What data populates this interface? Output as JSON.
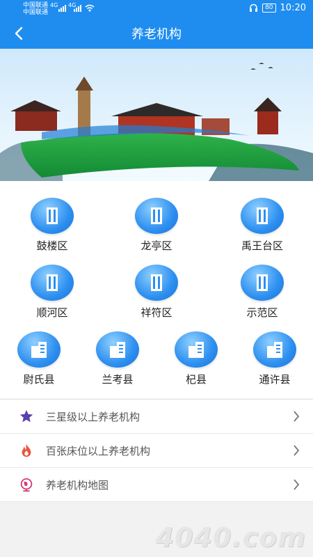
{
  "status": {
    "carrier1": "中国联通",
    "carrier2": "中国联通",
    "net1": "4G",
    "net2": "4G",
    "battery": "80",
    "time": "10:20"
  },
  "header": {
    "title": "养老机构",
    "back_icon": "chevron-left-icon"
  },
  "districts": [
    {
      "label": "鼓楼区"
    },
    {
      "label": "龙亭区"
    },
    {
      "label": "禹王台区"
    },
    {
      "label": "顺河区"
    },
    {
      "label": "祥符区"
    },
    {
      "label": "示范区"
    },
    {
      "label": "尉氏县"
    },
    {
      "label": "兰考县"
    },
    {
      "label": "杞县"
    },
    {
      "label": "通许县"
    }
  ],
  "menu": [
    {
      "label": "三星级以上养老机构",
      "icon": "star-icon",
      "color": "#5b3fb0"
    },
    {
      "label": "百张床位以上养老机构",
      "icon": "flame-icon",
      "color": "#e8553d"
    },
    {
      "label": "养老机构地图",
      "icon": "globe-icon",
      "color": "#d63a7a"
    }
  ],
  "watermark": "4040.com",
  "colors": {
    "primary": "#1f8df0"
  }
}
